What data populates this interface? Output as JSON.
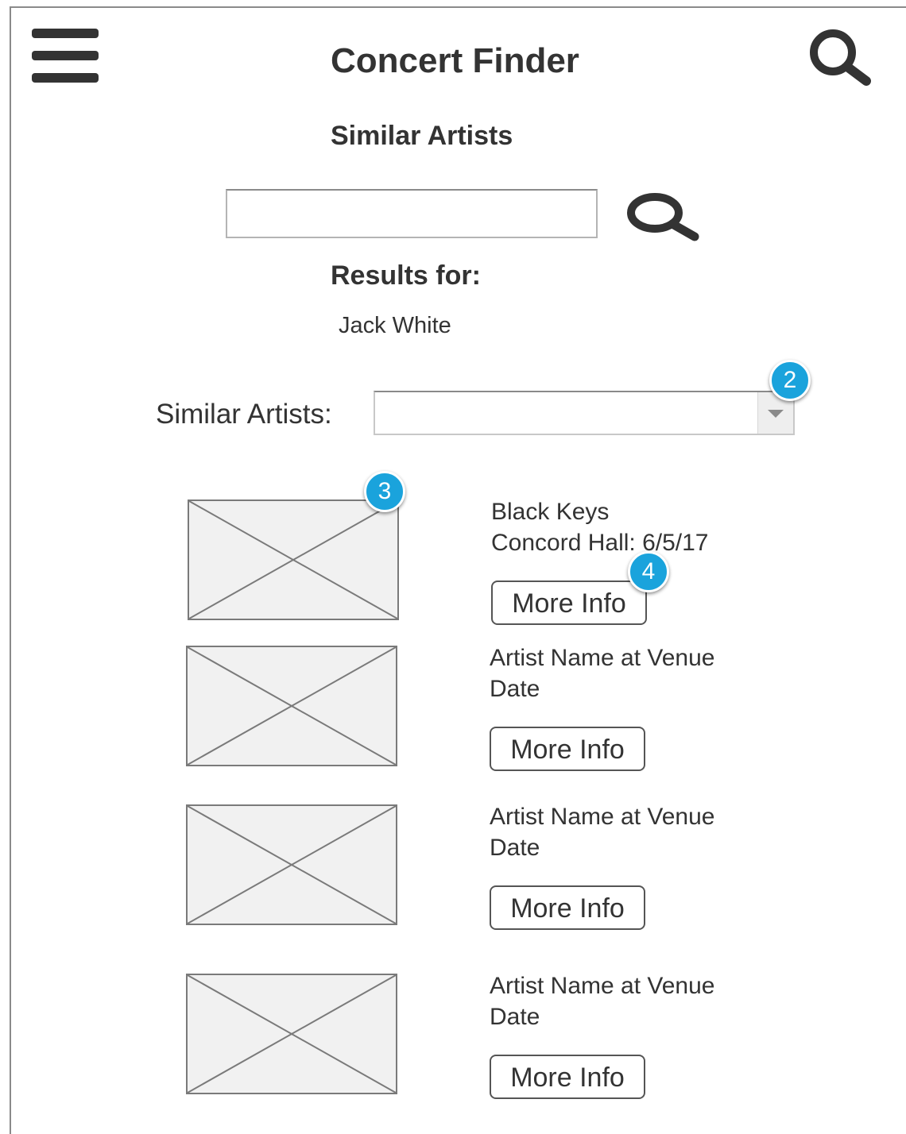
{
  "header": {
    "menu_icon": "hamburger-menu-icon",
    "title": "Concert Finder",
    "search_icon": "search-icon"
  },
  "section_title": "Similar Artists",
  "search": {
    "value": "",
    "placeholder": "",
    "button_icon": "search-icon"
  },
  "results": {
    "label": "Results for:",
    "query": "Jack White"
  },
  "similar_artists": {
    "label": "Similar Artists:",
    "selected": ""
  },
  "annotations": [
    "2",
    "3",
    "4"
  ],
  "accent_color": "#1aa3dc",
  "items": [
    {
      "line1": "Black Keys",
      "line2": "Concord Hall: 6/5/17",
      "button": "More Info",
      "image_icon": "image-placeholder-icon"
    },
    {
      "line1": "Artist Name at Venue",
      "line2": "Date",
      "button": "More Info",
      "image_icon": "image-placeholder-icon"
    },
    {
      "line1": "Artist Name at Venue",
      "line2": "Date",
      "button": "More Info",
      "image_icon": "image-placeholder-icon"
    },
    {
      "line1": "Artist Name at Venue",
      "line2": "Date",
      "button": "More Info",
      "image_icon": "image-placeholder-icon"
    }
  ]
}
